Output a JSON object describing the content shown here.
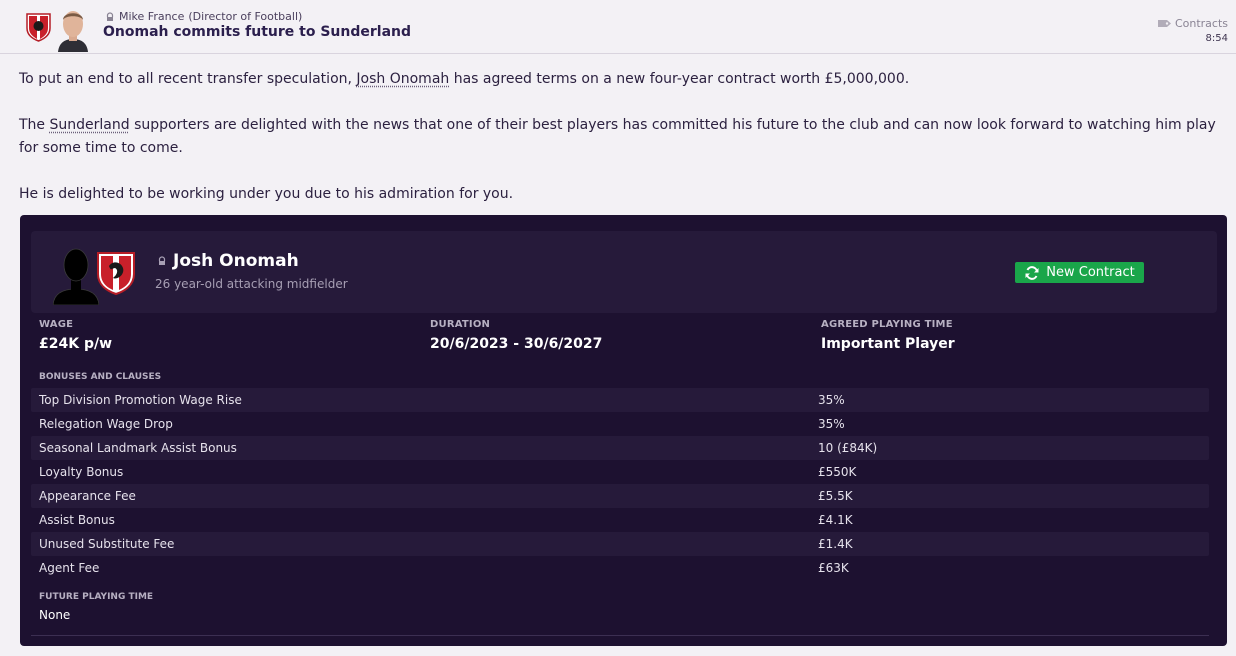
{
  "header": {
    "sender_name": "Mike France",
    "sender_role": "(Director of Football)",
    "subject": "Onomah commits future to Sunderland",
    "category": "Contracts",
    "time": "8:54"
  },
  "body": {
    "p1_before": "To put an end to all recent transfer speculation, ",
    "p1_link": "Josh Onomah",
    "p1_after": " has agreed terms on a new four-year contract worth £5,000,000.",
    "p2_before": "The ",
    "p2_link": "Sunderland",
    "p2_after": " supporters are delighted with the news that one of their best players has committed his future to the club and can now look forward to watching him play for some time to come.",
    "p3": "He is delighted to be working under you due to his admiration for you."
  },
  "player": {
    "name": "Josh Onomah",
    "description": "26 year-old attacking midfielder",
    "button_label": "New Contract"
  },
  "contract": {
    "wage_label": "WAGE",
    "wage_value": "£24K p/w",
    "duration_label": "DURATION",
    "duration_value": "20/6/2023 - 30/6/2027",
    "playing_time_label": "AGREED PLAYING TIME",
    "playing_time_value": "Important Player",
    "bonuses_label": "BONUSES AND CLAUSES",
    "bonuses": [
      {
        "label": "Top Division Promotion Wage Rise",
        "value": "35%"
      },
      {
        "label": "Relegation Wage Drop",
        "value": "35%"
      },
      {
        "label": "Seasonal Landmark Assist Bonus",
        "value": "10 (£84K)"
      },
      {
        "label": "Loyalty Bonus",
        "value": "£550K"
      },
      {
        "label": "Appearance Fee",
        "value": "£5.5K"
      },
      {
        "label": "Assist Bonus",
        "value": "£4.1K"
      },
      {
        "label": "Unused Substitute Fee",
        "value": "£1.4K"
      },
      {
        "label": "Agent Fee",
        "value": "£63K"
      }
    ],
    "future_label": "FUTURE PLAYING TIME",
    "future_value": "None"
  },
  "colors": {
    "panel_bg": "#1d1130",
    "card_bg": "#261a3a",
    "button_green": "#1aa64a",
    "club_red": "#c8202a"
  },
  "icons": [
    "club-badge-icon",
    "person-photo-icon",
    "lock-icon",
    "tag-icon",
    "player-silhouette-icon",
    "refresh-icon"
  ]
}
